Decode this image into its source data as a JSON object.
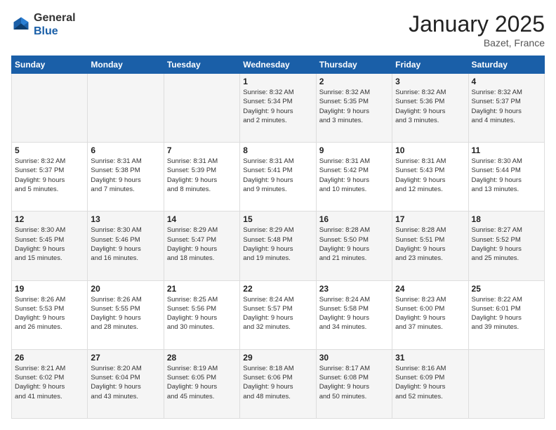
{
  "header": {
    "logo_general": "General",
    "logo_blue": "Blue",
    "month_title": "January 2025",
    "location": "Bazet, France"
  },
  "days_of_week": [
    "Sunday",
    "Monday",
    "Tuesday",
    "Wednesday",
    "Thursday",
    "Friday",
    "Saturday"
  ],
  "weeks": [
    [
      {
        "day": "",
        "info": ""
      },
      {
        "day": "",
        "info": ""
      },
      {
        "day": "",
        "info": ""
      },
      {
        "day": "1",
        "info": "Sunrise: 8:32 AM\nSunset: 5:34 PM\nDaylight: 9 hours\nand 2 minutes."
      },
      {
        "day": "2",
        "info": "Sunrise: 8:32 AM\nSunset: 5:35 PM\nDaylight: 9 hours\nand 3 minutes."
      },
      {
        "day": "3",
        "info": "Sunrise: 8:32 AM\nSunset: 5:36 PM\nDaylight: 9 hours\nand 3 minutes."
      },
      {
        "day": "4",
        "info": "Sunrise: 8:32 AM\nSunset: 5:37 PM\nDaylight: 9 hours\nand 4 minutes."
      }
    ],
    [
      {
        "day": "5",
        "info": "Sunrise: 8:32 AM\nSunset: 5:37 PM\nDaylight: 9 hours\nand 5 minutes."
      },
      {
        "day": "6",
        "info": "Sunrise: 8:31 AM\nSunset: 5:38 PM\nDaylight: 9 hours\nand 7 minutes."
      },
      {
        "day": "7",
        "info": "Sunrise: 8:31 AM\nSunset: 5:39 PM\nDaylight: 9 hours\nand 8 minutes."
      },
      {
        "day": "8",
        "info": "Sunrise: 8:31 AM\nSunset: 5:41 PM\nDaylight: 9 hours\nand 9 minutes."
      },
      {
        "day": "9",
        "info": "Sunrise: 8:31 AM\nSunset: 5:42 PM\nDaylight: 9 hours\nand 10 minutes."
      },
      {
        "day": "10",
        "info": "Sunrise: 8:31 AM\nSunset: 5:43 PM\nDaylight: 9 hours\nand 12 minutes."
      },
      {
        "day": "11",
        "info": "Sunrise: 8:30 AM\nSunset: 5:44 PM\nDaylight: 9 hours\nand 13 minutes."
      }
    ],
    [
      {
        "day": "12",
        "info": "Sunrise: 8:30 AM\nSunset: 5:45 PM\nDaylight: 9 hours\nand 15 minutes."
      },
      {
        "day": "13",
        "info": "Sunrise: 8:30 AM\nSunset: 5:46 PM\nDaylight: 9 hours\nand 16 minutes."
      },
      {
        "day": "14",
        "info": "Sunrise: 8:29 AM\nSunset: 5:47 PM\nDaylight: 9 hours\nand 18 minutes."
      },
      {
        "day": "15",
        "info": "Sunrise: 8:29 AM\nSunset: 5:48 PM\nDaylight: 9 hours\nand 19 minutes."
      },
      {
        "day": "16",
        "info": "Sunrise: 8:28 AM\nSunset: 5:50 PM\nDaylight: 9 hours\nand 21 minutes."
      },
      {
        "day": "17",
        "info": "Sunrise: 8:28 AM\nSunset: 5:51 PM\nDaylight: 9 hours\nand 23 minutes."
      },
      {
        "day": "18",
        "info": "Sunrise: 8:27 AM\nSunset: 5:52 PM\nDaylight: 9 hours\nand 25 minutes."
      }
    ],
    [
      {
        "day": "19",
        "info": "Sunrise: 8:26 AM\nSunset: 5:53 PM\nDaylight: 9 hours\nand 26 minutes."
      },
      {
        "day": "20",
        "info": "Sunrise: 8:26 AM\nSunset: 5:55 PM\nDaylight: 9 hours\nand 28 minutes."
      },
      {
        "day": "21",
        "info": "Sunrise: 8:25 AM\nSunset: 5:56 PM\nDaylight: 9 hours\nand 30 minutes."
      },
      {
        "day": "22",
        "info": "Sunrise: 8:24 AM\nSunset: 5:57 PM\nDaylight: 9 hours\nand 32 minutes."
      },
      {
        "day": "23",
        "info": "Sunrise: 8:24 AM\nSunset: 5:58 PM\nDaylight: 9 hours\nand 34 minutes."
      },
      {
        "day": "24",
        "info": "Sunrise: 8:23 AM\nSunset: 6:00 PM\nDaylight: 9 hours\nand 37 minutes."
      },
      {
        "day": "25",
        "info": "Sunrise: 8:22 AM\nSunset: 6:01 PM\nDaylight: 9 hours\nand 39 minutes."
      }
    ],
    [
      {
        "day": "26",
        "info": "Sunrise: 8:21 AM\nSunset: 6:02 PM\nDaylight: 9 hours\nand 41 minutes."
      },
      {
        "day": "27",
        "info": "Sunrise: 8:20 AM\nSunset: 6:04 PM\nDaylight: 9 hours\nand 43 minutes."
      },
      {
        "day": "28",
        "info": "Sunrise: 8:19 AM\nSunset: 6:05 PM\nDaylight: 9 hours\nand 45 minutes."
      },
      {
        "day": "29",
        "info": "Sunrise: 8:18 AM\nSunset: 6:06 PM\nDaylight: 9 hours\nand 48 minutes."
      },
      {
        "day": "30",
        "info": "Sunrise: 8:17 AM\nSunset: 6:08 PM\nDaylight: 9 hours\nand 50 minutes."
      },
      {
        "day": "31",
        "info": "Sunrise: 8:16 AM\nSunset: 6:09 PM\nDaylight: 9 hours\nand 52 minutes."
      },
      {
        "day": "",
        "info": ""
      }
    ]
  ]
}
